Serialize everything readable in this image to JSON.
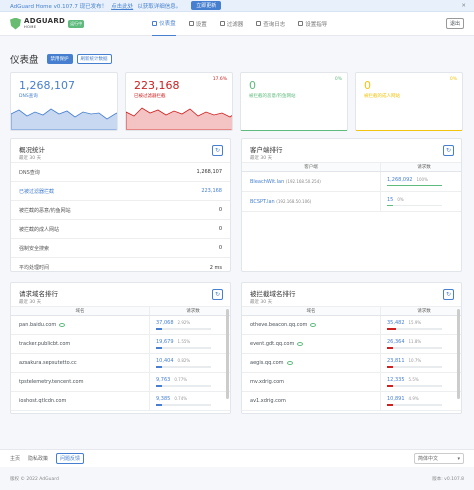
{
  "banner": {
    "text": "AdGuard Home v0.107.7 现已发布！",
    "link": "点击此处",
    "text2": "以获取详细信息。",
    "update_button": "立即更新"
  },
  "header": {
    "brand": "ADGUARD",
    "brand_sub": "HOME",
    "badge": "运行中",
    "nav": [
      {
        "label": "仪表盘",
        "icon": "dashboard-icon"
      },
      {
        "label": "设置",
        "icon": "settings-icon"
      },
      {
        "label": "过滤器",
        "icon": "filters-icon"
      },
      {
        "label": "查询日志",
        "icon": "log-icon"
      },
      {
        "label": "设置指导",
        "icon": "guide-icon"
      }
    ],
    "logout": "退出"
  },
  "title": {
    "text": "仪表盘",
    "disable_protection": "禁用保护",
    "refresh_stats": "刷新统计数据"
  },
  "stats": [
    {
      "value": "1,268,107",
      "label": "DNS查询",
      "percent": "",
      "color": "#467fcf"
    },
    {
      "value": "223,168",
      "label": "已被过滤器拦截",
      "percent": "17.6%",
      "color": "#cd201f"
    },
    {
      "value": "0",
      "label": "被拦截的恶意/钓鱼网站",
      "percent": "0%",
      "color": "#5eba7d"
    },
    {
      "value": "0",
      "label": "被拦截的成人网站",
      "percent": "0%",
      "color": "#f1c40f"
    }
  ],
  "general": {
    "title": "概况统计",
    "subtitle": "最近 30 天",
    "rows": [
      {
        "label": "DNS查询",
        "value": "1,268,107",
        "highlight": false
      },
      {
        "label": "已被过滤器拦截",
        "value": "223,168",
        "highlight": true
      },
      {
        "label": "被拦截的恶意/钓鱼网站",
        "value": "0",
        "highlight": false
      },
      {
        "label": "被拦截的成人网站",
        "value": "0",
        "highlight": false
      },
      {
        "label": "强制安全搜索",
        "value": "0",
        "highlight": false
      },
      {
        "label": "平均处理时间",
        "value": "2 ms",
        "highlight": false
      }
    ]
  },
  "clients": {
    "title": "客户端排行",
    "subtitle": "最近 30 天",
    "col1": "客户端",
    "col2": "请求数",
    "rows": [
      {
        "name": "BleachWit.lan",
        "ip": "(192.168.50.254)",
        "count": "1,268,092",
        "percent": "100%",
        "fill": 1.0,
        "color": "#5eba7d"
      },
      {
        "name": "BCSPT.lan",
        "ip": "(192.168.50.106)",
        "count": "15",
        "percent": "0%",
        "fill": 0.0,
        "color": "#5eba7d"
      }
    ]
  },
  "top_domains": {
    "title": "请求域名排行",
    "subtitle": "最近 30 天",
    "col1": "域名",
    "col2": "请求数",
    "rows": [
      {
        "domain": "pan.baidu.com",
        "count": "37,068",
        "percent": "2.92%",
        "fill": 0.0292,
        "icon": true
      },
      {
        "domain": "tracker.publicbt.com",
        "count": "19,679",
        "percent": "1.55%",
        "fill": 0.0155,
        "icon": false
      },
      {
        "domain": "azsakura.sepsutetto.cc",
        "count": "10,404",
        "percent": "0.82%",
        "fill": 0.0082,
        "icon": false
      },
      {
        "domain": "tpstelemetry.tencent.com",
        "count": "9,763",
        "percent": "0.77%",
        "fill": 0.0077,
        "icon": false
      },
      {
        "domain": "ioshost.qtlcdn.com",
        "count": "9,385",
        "percent": "0.74%",
        "fill": 0.0074,
        "icon": false
      }
    ]
  },
  "blocked_domains": {
    "title": "被拦截域名排行",
    "subtitle": "最近 30 天",
    "col1": "域名",
    "col2": "请求数",
    "rows": [
      {
        "domain": "otheve.beacon.qq.com",
        "count": "35,482",
        "percent": "15.9%",
        "fill": 0.159,
        "icon": true
      },
      {
        "domain": "event.gdt.qq.com",
        "count": "26,364",
        "percent": "11.8%",
        "fill": 0.118,
        "icon": true
      },
      {
        "domain": "aegis.qq.com",
        "count": "23,811",
        "percent": "10.7%",
        "fill": 0.107,
        "icon": true
      },
      {
        "domain": "mv.xdrig.com",
        "count": "12,335",
        "percent": "5.5%",
        "fill": 0.055,
        "icon": false
      },
      {
        "domain": "av1.xdrig.com",
        "count": "10,891",
        "percent": "4.9%",
        "fill": 0.049,
        "icon": false
      }
    ]
  },
  "footer": {
    "home": "主页",
    "privacy": "隐私政策",
    "report": "问题反馈",
    "language": "简体中文",
    "copyright": "版权 © 2022 AdGuard",
    "version": "版本: v0.107.8"
  }
}
